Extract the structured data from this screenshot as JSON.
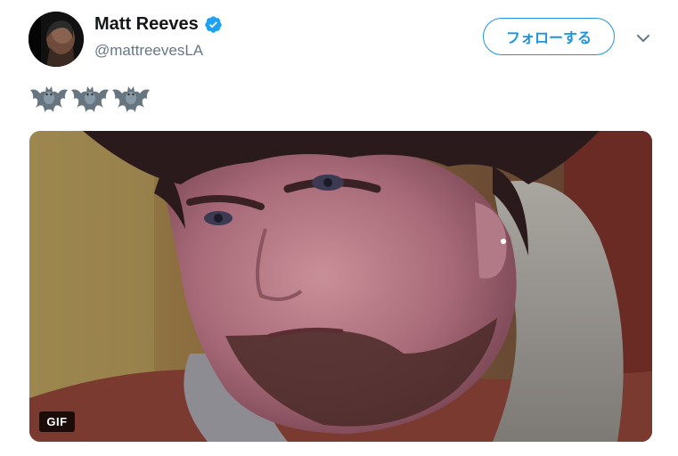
{
  "author": {
    "display_name": "Matt Reeves",
    "handle": "@mattreevesLA",
    "verified": true
  },
  "actions": {
    "follow_label": "フォローする",
    "menu_icon": "chevron-down-icon"
  },
  "tweet": {
    "emojis": [
      "bat-icon",
      "bat-icon",
      "bat-icon"
    ]
  },
  "media": {
    "badge": "GIF"
  },
  "colors": {
    "accent": "#1b95e0",
    "name": "#14171a",
    "secondary_text": "#657786"
  }
}
